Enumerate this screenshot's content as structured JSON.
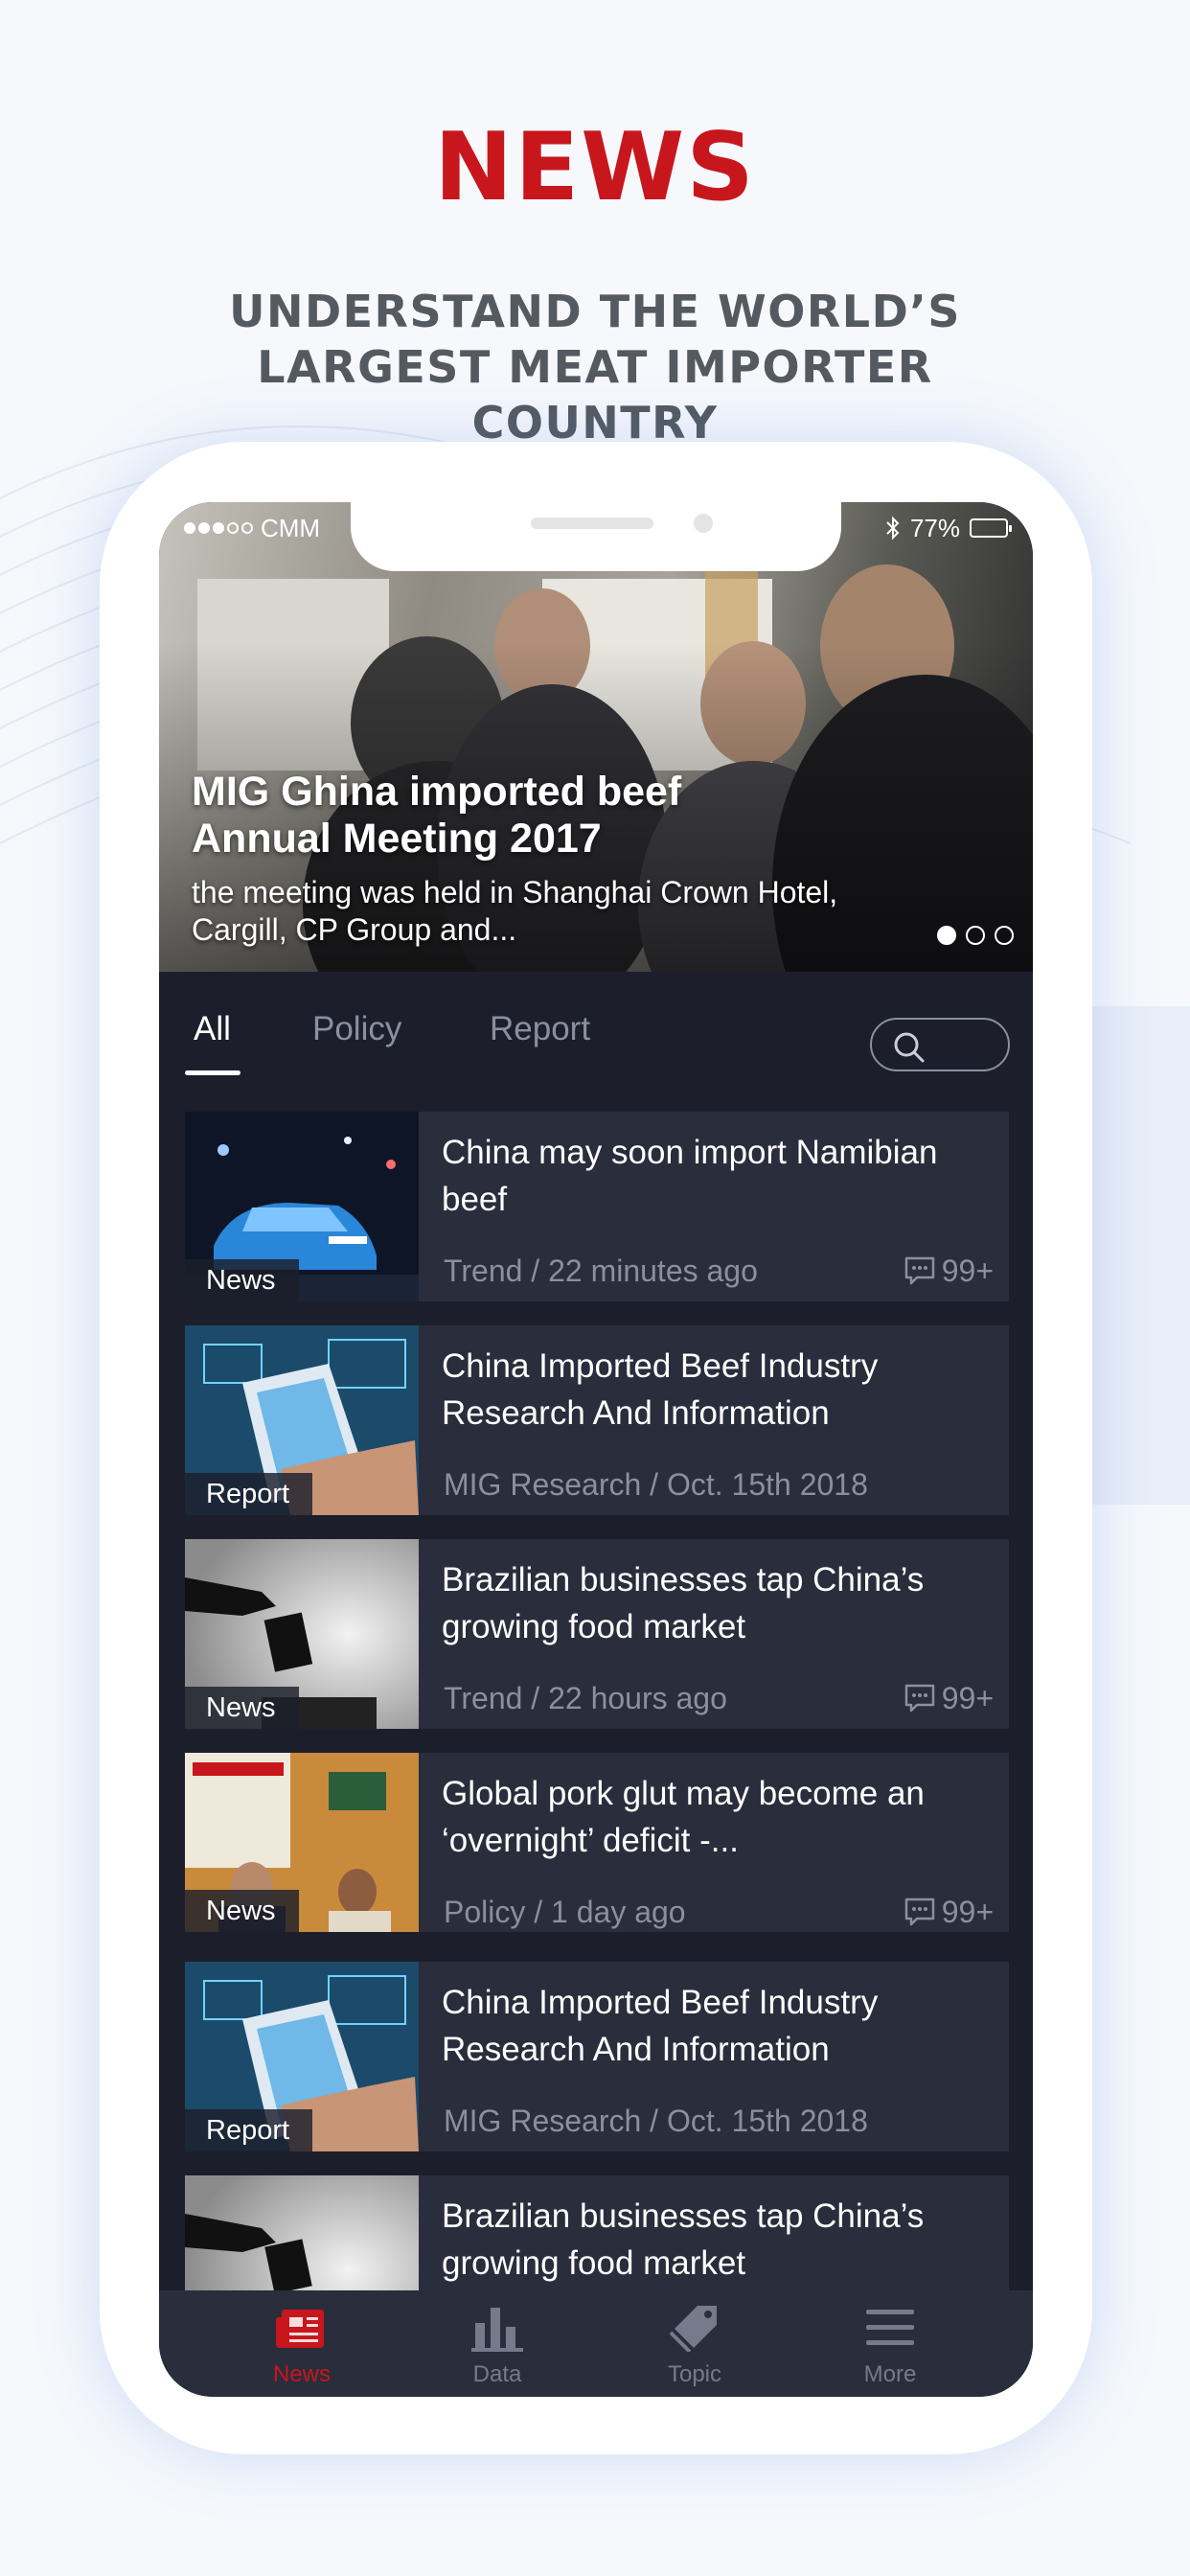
{
  "promo": {
    "title": "NEWS",
    "subtitle": "UNDERSTAND THE WORLD’S LARGEST MEAT IMPORTER COUNTRY"
  },
  "status_bar": {
    "carrier": "CMM",
    "battery": "77%",
    "bluetooth_icon": "bluetooth-icon"
  },
  "hero": {
    "title": "MIG Ghina imported beef Annual Meeting 2017",
    "description": "the meeting was held in Shanghai Crown Hotel, Cargill,  CP Group and...",
    "pages": 3,
    "active_page": 1
  },
  "tabs": [
    {
      "label": "All",
      "active": true
    },
    {
      "label": "Policy",
      "active": false
    },
    {
      "label": "Report",
      "active": false
    }
  ],
  "search": {
    "icon": "search-icon"
  },
  "articles": [
    {
      "tag": "News",
      "title": "China may soon import Namibian beef",
      "meta": "Trend / 22 minutes ago",
      "comments": "99+",
      "thumb": "car-night"
    },
    {
      "tag": "Report",
      "title": "China Imported Beef Industry Research And Information",
      "meta": "MIG Research / Oct. 15th 2018",
      "comments": "",
      "thumb": "hand-phone"
    },
    {
      "tag": "News",
      "title": "Brazilian businesses tap China’s growing food market",
      "meta": "Trend / 22 hours ago",
      "comments": "99+",
      "thumb": "ballot"
    },
    {
      "tag": "News",
      "title": "Global pork glut may become an ‘overnight’ deficit -...",
      "meta": "Policy / 1 day ago",
      "comments": "99+",
      "thumb": "conference"
    },
    {
      "tag": "Report",
      "title": "China Imported Beef Industry Research And Information",
      "meta": "MIG Research / Oct. 15th 2018",
      "comments": "",
      "thumb": "hand-phone"
    },
    {
      "tag": "",
      "title": "Brazilian businesses tap China’s growing food market",
      "meta": "",
      "comments": "",
      "thumb": "ballot"
    }
  ],
  "bottom_nav": [
    {
      "label": "News",
      "icon": "newspaper-icon",
      "active": true
    },
    {
      "label": "Data",
      "icon": "bar-chart-icon",
      "active": false
    },
    {
      "label": "Topic",
      "icon": "tag-icon",
      "active": false
    },
    {
      "label": "More",
      "icon": "menu-icon",
      "active": false
    }
  ],
  "colors": {
    "accent": "#c8161d",
    "background": "#1c1f2b",
    "card": "#2a2d3b",
    "muted": "#8a90a0"
  }
}
